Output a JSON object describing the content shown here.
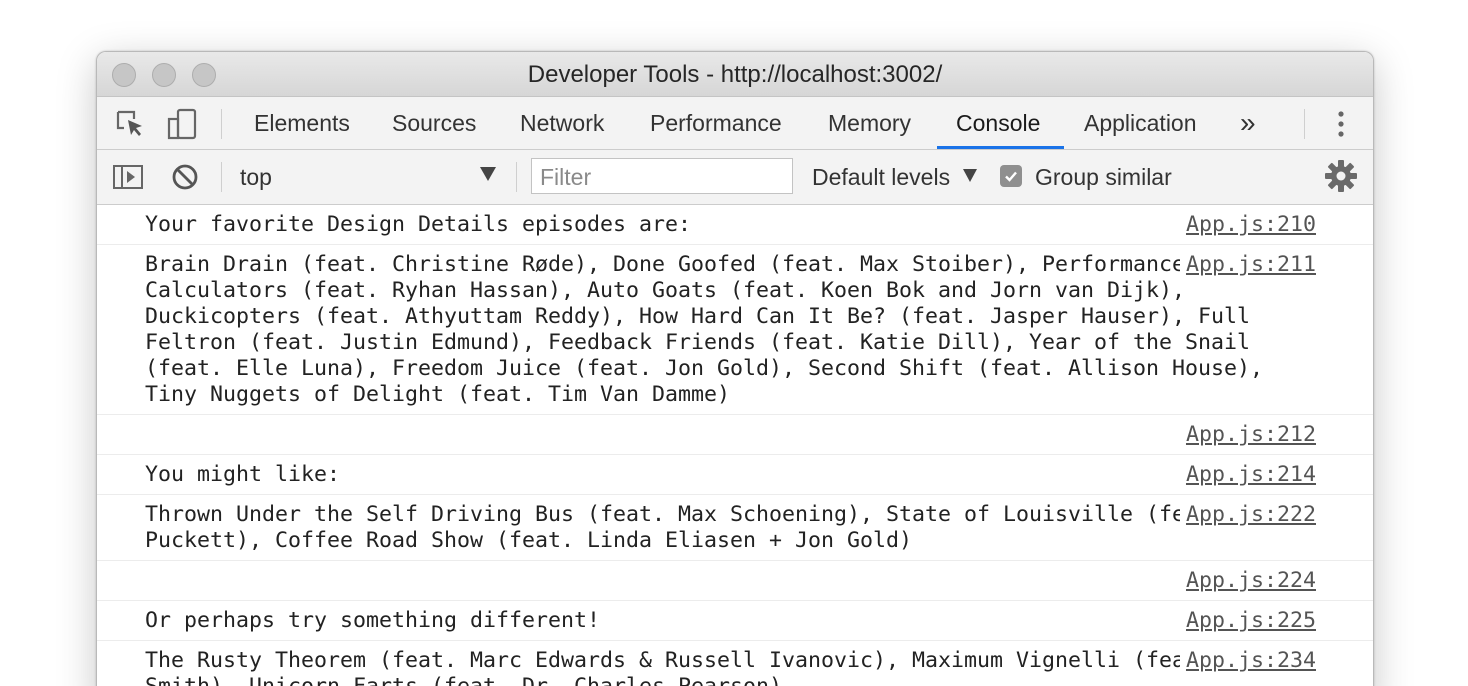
{
  "window": {
    "title": "Developer Tools - http://localhost:3002/"
  },
  "tabs": [
    {
      "label": "Elements",
      "active": false
    },
    {
      "label": "Sources",
      "active": false
    },
    {
      "label": "Network",
      "active": false
    },
    {
      "label": "Performance",
      "active": false
    },
    {
      "label": "Memory",
      "active": false
    },
    {
      "label": "Console",
      "active": true
    },
    {
      "label": "Application",
      "active": false
    }
  ],
  "tabs_overflow": "»",
  "toolbar": {
    "context": "top",
    "filter_placeholder": "Filter",
    "levels": "Default levels",
    "group_similar_label": "Group similar",
    "group_similar_checked": true
  },
  "icons": {
    "inspect": "inspect-element-icon",
    "device": "device-toolbar-icon",
    "more": "more-vertical-icon",
    "sidebar": "show-sidebar-icon",
    "clear": "clear-console-icon",
    "settings": "gear-icon"
  },
  "colors": {
    "active_tab_underline": "#1a73e8",
    "toolbar_background": "#f3f3f3"
  },
  "messages": [
    {
      "text": "Your favorite Design Details episodes are:",
      "source": "App.js:210"
    },
    {
      "text": "Brain Drain (feat. Christine Røde), Done Goofed (feat. Max Stoiber), Performance Enhancing Calculators (feat. Ryhan Hassan), Auto Goats (feat. Koen Bok and Jorn van Dijk), Duckicopters (feat. Athyuttam Reddy), How Hard Can It Be? (feat. Jasper Hauser), Full Feltron (feat. Justin Edmund), Feedback Friends (feat. Katie Dill), Year of the Snail (feat. Elle Luna), Freedom Juice (feat. Jon Gold), Second Shift (feat. Allison House), Tiny Nuggets of Delight (feat. Tim Van Damme)",
      "source": "App.js:211"
    },
    {
      "text": "",
      "source": "App.js:212"
    },
    {
      "text": "You might like:",
      "source": "App.js:214"
    },
    {
      "text": "Thrown Under the Self Driving Bus (feat. Max Schoening), State of Louisville (feat. Josh Puckett), Coffee Road Show (feat. Linda Eliasen + Jon Gold)",
      "source": "App.js:222"
    },
    {
      "text": "",
      "source": "App.js:224"
    },
    {
      "text": "Or perhaps try something different!",
      "source": "App.js:225"
    },
    {
      "text": "The Rusty Theorem (feat. Marc Edwards & Russell Ivanovic), Maximum Vignelli (feat. Lucas Smith), Unicorn Farts (feat. Dr. Charles Pearson)",
      "source": "App.js:234"
    }
  ]
}
